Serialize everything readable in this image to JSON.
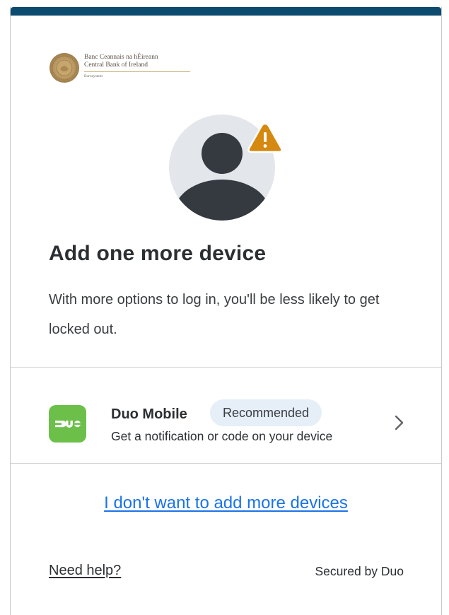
{
  "logo": {
    "line1": "Banc Ceannais na hÉireann",
    "line2": "Central Bank of Ireland",
    "sub": "Eurosystem"
  },
  "title": "Add one more device",
  "description": "With more options to log in, you'll be less likely to get locked out.",
  "option": {
    "name": "Duo Mobile",
    "badge": "Recommended",
    "subtitle": "Get a notification or code on your device",
    "icon": "duo-mobile-icon"
  },
  "skip_link": "I don't want to add more devices",
  "help_link": "Need help?",
  "footer_secured": "Secured by Duo",
  "colors": {
    "top_bar": "#0c4a6e",
    "duo_green": "#6cc04a",
    "warning": "#d68910",
    "link_blue": "#1a73e8",
    "badge_bg": "#e6eef7"
  }
}
